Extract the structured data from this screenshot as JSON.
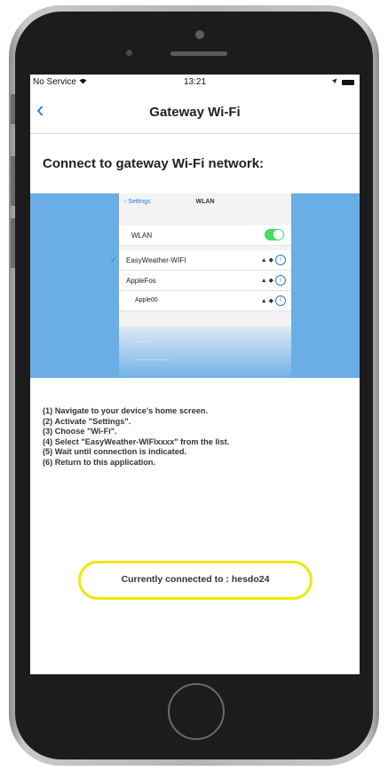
{
  "statusbar": {
    "carrier": "No Service",
    "time": "13:21"
  },
  "navbar": {
    "back_glyph": "‹",
    "title": "Gateway Wi-Fi"
  },
  "heading": "Connect to gateway Wi-Fi network:",
  "illustration": {
    "back_label": "‹ Settings",
    "title": "WLAN",
    "wlan_label": "WLAN",
    "networks": [
      {
        "name": "EasyWeather-WIFI",
        "signal": "▲ ◆",
        "selected": true
      },
      {
        "name": "AppleFos",
        "signal": "▲ ◆",
        "selected": false
      },
      {
        "name": "Apple00",
        "signal": "▲ ◆",
        "selected": false
      }
    ],
    "ghost_rows": [
      "-------",
      "------------------"
    ]
  },
  "steps": [
    "(1) Navigate to your device's home screen.",
    "(2) Activate \"Settings\".",
    "(3) Choose \"Wi-Fi\".",
    "(4) Select \"EasyWeather-WIFIxxxx\" from the list.",
    "(5) Wait until connection is indicated.",
    "(6) Return to this application."
  ],
  "connection_status": "Currently connected to : hesdo24",
  "colors": {
    "accent": "#2a7ad6",
    "highlight": "#f0e800",
    "toggle_on": "#4cd964",
    "banner": "#6aaee6"
  }
}
